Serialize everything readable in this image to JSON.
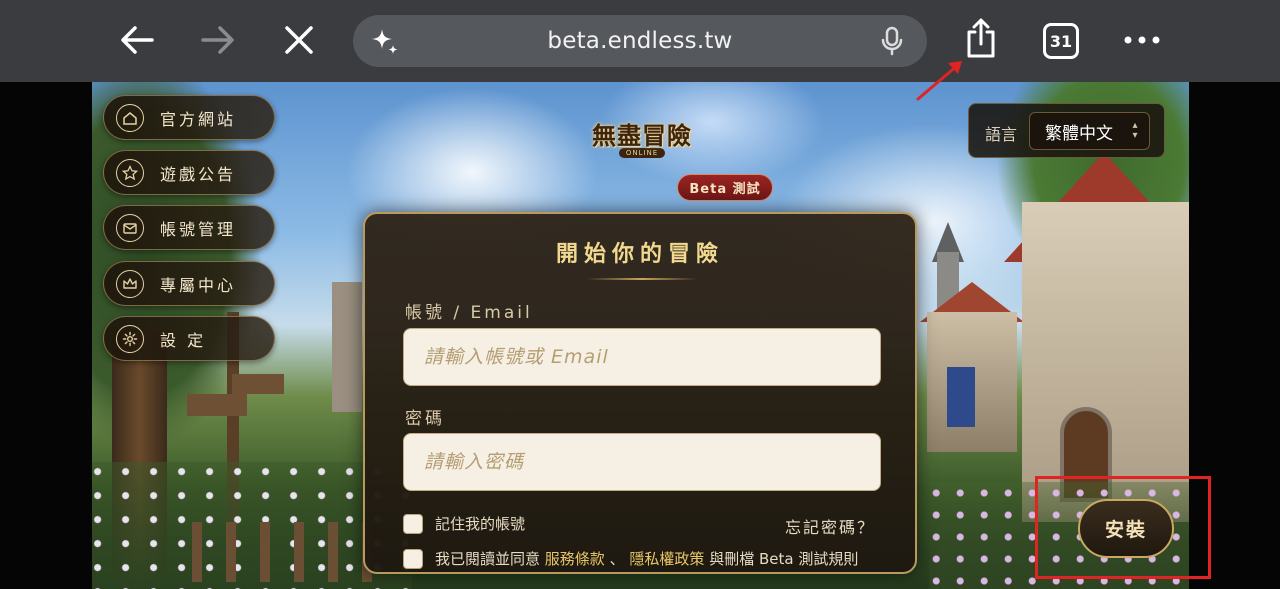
{
  "browser": {
    "url": "beta.endless.tw",
    "tab_count": "31",
    "icons": [
      "back-arrow-icon",
      "forward-arrow-icon",
      "close-icon",
      "sparkle-icon",
      "microphone-icon",
      "share-icon",
      "tabs-icon",
      "more-icon"
    ]
  },
  "sidebar": {
    "items": [
      {
        "label": "官方網站",
        "icon": "home-icon"
      },
      {
        "label": "遊戲公告",
        "icon": "star-icon"
      },
      {
        "label": "帳號管理",
        "icon": "mail-icon"
      },
      {
        "label": "專屬中心",
        "icon": "crown-icon"
      },
      {
        "label": "設 定",
        "icon": "gear-icon"
      }
    ]
  },
  "header": {
    "logo_title": "無盡冒險",
    "logo_sub": "ONLINE",
    "beta_badge": "Beta 測試"
  },
  "language": {
    "label": "語言",
    "selected": "繁體中文"
  },
  "login": {
    "title": "開始你的冒險",
    "account_label": "帳號 / Email",
    "account_placeholder": "請輸入帳號或 Email",
    "password_label": "密碼",
    "password_placeholder": "請輸入密碼",
    "remember_label": "記住我的帳號",
    "forgot_label": "忘記密碼？",
    "agree_prefix": "我已閱讀並同意",
    "terms_link": "服務條款",
    "separator": "、",
    "privacy_link": "隱私權政策",
    "agree_suffix": "與刪檔 Beta 測試規則"
  },
  "install": {
    "label": "安裝"
  },
  "colors": {
    "accent_gold": "#e9c766",
    "badge_red": "#9a2424",
    "annotation_red": "#e02424"
  }
}
